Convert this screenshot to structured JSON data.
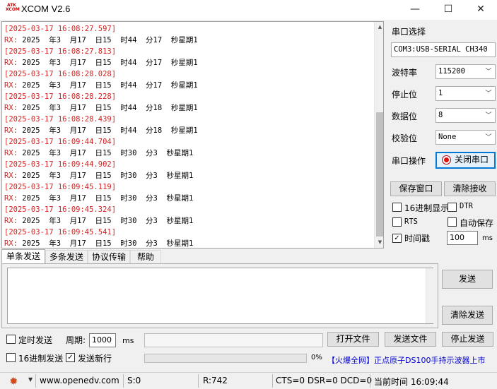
{
  "app": {
    "title": "XCOM V2.6",
    "logo_lines": [
      "ATK",
      "XCOM"
    ]
  },
  "window_controls": {
    "minimize": "—",
    "maximize": "☐",
    "close": "✕"
  },
  "receive_log": [
    {
      "kind": "ts",
      "text": "[2025-03-17 16:08:27.597]"
    },
    {
      "kind": "rx",
      "label": "RX:",
      "text": " 2025  年3  月17  日15  时44  分17  秒星期1"
    },
    {
      "kind": "ts",
      "text": "[2025-03-17 16:08:27.813]"
    },
    {
      "kind": "rx",
      "label": "RX:",
      "text": " 2025  年3  月17  日15  时44  分17  秒星期1"
    },
    {
      "kind": "ts",
      "text": "[2025-03-17 16:08:28.028]"
    },
    {
      "kind": "rx",
      "label": "RX:",
      "text": " 2025  年3  月17  日15  时44  分17  秒星期1"
    },
    {
      "kind": "ts",
      "text": "[2025-03-17 16:08:28.228]"
    },
    {
      "kind": "rx",
      "label": "RX:",
      "text": " 2025  年3  月17  日15  时44  分18  秒星期1"
    },
    {
      "kind": "ts",
      "text": "[2025-03-17 16:08:28.439]"
    },
    {
      "kind": "rx",
      "label": "RX:",
      "text": " 2025  年3  月17  日15  时44  分18  秒星期1"
    },
    {
      "kind": "ts",
      "text": "[2025-03-17 16:09:44.704]"
    },
    {
      "kind": "rx",
      "label": "RX:",
      "text": " 2025  年3  月17  日15  时30  分3  秒星期1"
    },
    {
      "kind": "ts",
      "text": "[2025-03-17 16:09:44.902]"
    },
    {
      "kind": "rx",
      "label": "RX:",
      "text": " 2025  年3  月17  日15  时30  分3  秒星期1"
    },
    {
      "kind": "ts",
      "text": "[2025-03-17 16:09:45.119]"
    },
    {
      "kind": "rx",
      "label": "RX:",
      "text": " 2025  年3  月17  日15  时30  分3  秒星期1"
    },
    {
      "kind": "ts",
      "text": "[2025-03-17 16:09:45.324]"
    },
    {
      "kind": "rx",
      "label": "RX:",
      "text": " 2025  年3  月17  日15  时30  分3  秒星期1"
    },
    {
      "kind": "ts",
      "text": "[2025-03-17 16:09:45.541]"
    },
    {
      "kind": "rx",
      "label": "RX:",
      "text": " 2025  年3  月17  日15  时30  分3  秒星期1"
    }
  ],
  "serial": {
    "port_select_label": "串口选择",
    "port_value": "COM3:USB-SERIAL CH340",
    "baud_label": "波特率",
    "baud_value": "115200",
    "stopbits_label": "停止位",
    "stopbits_value": "1",
    "databits_label": "数据位",
    "databits_value": "8",
    "parity_label": "校验位",
    "parity_value": "None",
    "op_label": "串口操作",
    "close_port_label": "关闭串口"
  },
  "recv_buttons": {
    "save_window": "保存窗口",
    "clear_recv": "清除接收"
  },
  "options": {
    "hex_display": {
      "label": "16进制显示",
      "checked": false
    },
    "dtr": {
      "label": "DTR",
      "checked": false
    },
    "rts": {
      "label": "RTS",
      "checked": false
    },
    "auto_save": {
      "label": "自动保存",
      "checked": false
    },
    "timestamp": {
      "label": "时间戳",
      "checked": true
    },
    "timestamp_ms": "100",
    "ms_unit": "ms"
  },
  "tabs": [
    "单条发送",
    "多条发送",
    "协议传输",
    "帮助"
  ],
  "send": {
    "send_label": "发送",
    "clear_send_label": "清除发送",
    "timed_send": {
      "label": "定时发送",
      "checked": false
    },
    "period_label": "周期:",
    "period_value": "1000",
    "period_unit": "ms",
    "open_file": "打开文件",
    "send_file": "发送文件",
    "stop_send": "停止发送",
    "hex_send": {
      "label": "16进制发送",
      "checked": false
    },
    "send_newline": {
      "label": "发送新行",
      "checked": true
    },
    "progress_pct": "0%",
    "progress_value": 0
  },
  "ad": {
    "prefix": "【火爆全网】",
    "text": "正点原子DS100手持示波器上市"
  },
  "status": {
    "website": "www.openedv.com",
    "sent": "S:0",
    "received": "R:742",
    "lines": "CTS=0 DSR=0 DCD=0",
    "time": "当前时间 16:09:44"
  },
  "colors": {
    "timestamp": "#d42020",
    "accent": "#0078d7",
    "led": "#e01010"
  }
}
